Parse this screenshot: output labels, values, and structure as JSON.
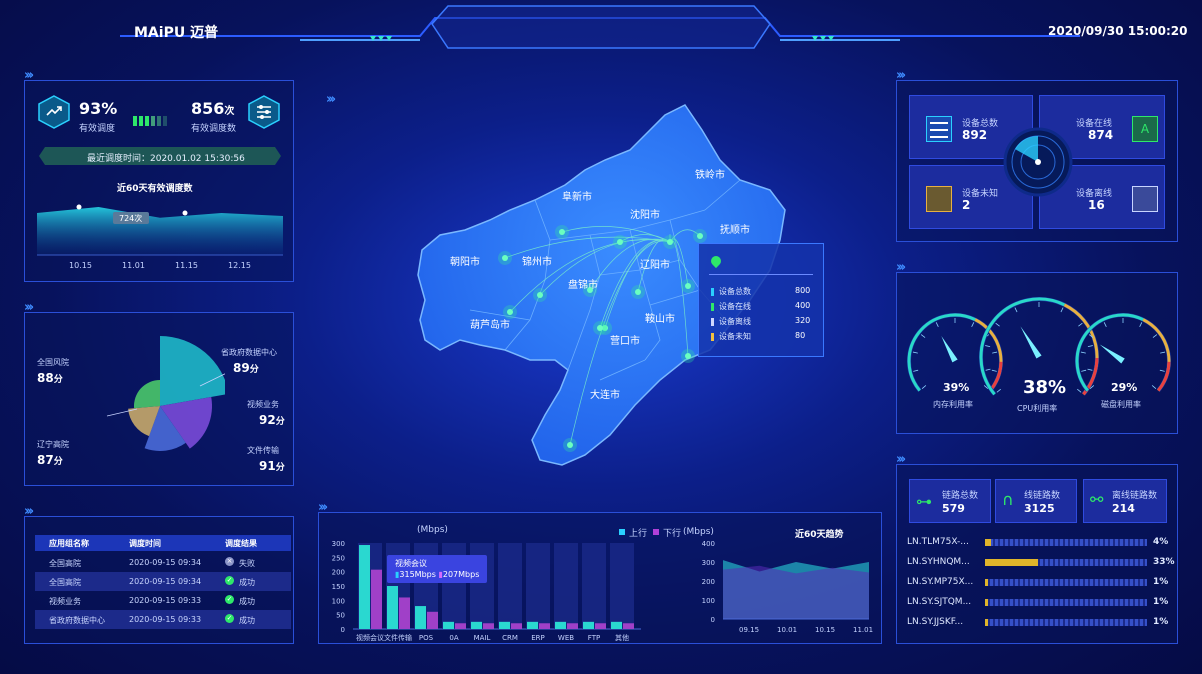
{
  "brand": {
    "logo_text": "MAiPU",
    "logo_cn": "迈普"
  },
  "datetime": "2020/09/30  15:00:20",
  "dispatch": {
    "rate_value": "93%",
    "rate_label": "有效调度",
    "count_value": "856",
    "count_unit": "次",
    "count_label": "有效调度数",
    "last_time": "最近调度时间：2020.01.02  15:30:56",
    "chart_title": "近60天有效调度数",
    "tooltip": "724次",
    "x_ticks": [
      "10.15",
      "11.01",
      "11.15",
      "12.15"
    ]
  },
  "score": {
    "items": [
      {
        "name": "全国风院",
        "value": "88",
        "unit": "分"
      },
      {
        "name": "省政府数据中心",
        "value": "89",
        "unit": "分"
      },
      {
        "name": "视频业务",
        "value": "92",
        "unit": "分"
      },
      {
        "name": "文件传输",
        "value": "91",
        "unit": "分"
      },
      {
        "name": "辽宁高院",
        "value": "87",
        "unit": "分"
      }
    ]
  },
  "table": {
    "headers": [
      "应用组名称",
      "调度时间",
      "调度结果"
    ],
    "rows": [
      {
        "name": "全国高院",
        "time": "2020-09-15 09:34",
        "result": "失败",
        "ok": false
      },
      {
        "name": "全国高院",
        "time": "2020-09-15 09:34",
        "result": "成功",
        "ok": true
      },
      {
        "name": "视频业务",
        "time": "2020-09-15 09:33",
        "result": "成功",
        "ok": true
      },
      {
        "name": "省政府数据中心",
        "time": "2020-09-15 09:33",
        "result": "成功",
        "ok": true
      }
    ]
  },
  "map": {
    "cities": [
      "铁岭市",
      "阜新市",
      "沈阳市",
      "抚顺市",
      "朝阳市",
      "锦州市",
      "辽阳市",
      "盘锦市",
      "鞍山市",
      "葫芦岛市",
      "营口市",
      "大连市"
    ],
    "tooltip": {
      "rows": [
        {
          "label": "设备总数",
          "value": "800",
          "color": "#2ad0ff"
        },
        {
          "label": "设备在线",
          "value": "400",
          "color": "#2ee86a"
        },
        {
          "label": "设备离线",
          "value": "320",
          "color": "#cfd8ff"
        },
        {
          "label": "设备未知",
          "value": "80",
          "color": "#f0c040"
        }
      ]
    }
  },
  "devices": {
    "total_label": "设备总数",
    "total": "892",
    "online_label": "设备在线",
    "online": "874",
    "unknown_label": "设备未知",
    "unknown": "2",
    "offline_label": "设备离线",
    "offline": "16"
  },
  "gauges": [
    {
      "value": "39%",
      "label": "内存利用率",
      "fraction": 0.39
    },
    {
      "value": "38%",
      "label": "CPU利用率",
      "fraction": 0.38
    },
    {
      "value": "29%",
      "label": "磁盘利用率",
      "fraction": 0.29
    }
  ],
  "links": {
    "total_label": "链路总数",
    "total": "579",
    "online_label": "线链路数",
    "online": "3125",
    "offline_label": "离线链路数",
    "offline": "214",
    "rows": [
      {
        "name": "LN.TLM75X-...",
        "pct": "4%",
        "fraction": 0.04
      },
      {
        "name": "LN.SYHNQM...",
        "pct": "33%",
        "fraction": 0.33
      },
      {
        "name": "LN.SY.MP75X...",
        "pct": "1%",
        "fraction": 0.01
      },
      {
        "name": "LN.SY.SJTQM...",
        "pct": "1%",
        "fraction": 0.01
      },
      {
        "name": "LN.SY.JJSKF...",
        "pct": "1%",
        "fraction": 0.01
      }
    ]
  },
  "traffic": {
    "unit": "(Mbps)",
    "legend_up": "上行",
    "legend_down": "下行",
    "tooltip_title": "视频会议",
    "tooltip_up": "315Mbps",
    "tooltip_down": "207Mbps"
  },
  "trend": {
    "unit": "(Mbps)",
    "title": "近60天趋势"
  },
  "chart_data": [
    {
      "type": "bar",
      "categories": [
        "视频会议",
        "文件传输",
        "POS",
        "0A",
        "MAIL",
        "CRM",
        "ERP",
        "WEB",
        "FTP",
        "其他"
      ],
      "series": [
        {
          "name": "上行",
          "values": [
            315,
            150,
            80,
            25,
            25,
            25,
            25,
            25,
            25,
            25
          ]
        },
        {
          "name": "下行",
          "values": [
            207,
            110,
            60,
            20,
            20,
            20,
            20,
            20,
            20,
            20
          ]
        }
      ],
      "ylabel": "(Mbps)",
      "ylim": [
        0,
        300
      ],
      "yticks": [
        0,
        50,
        100,
        150,
        200,
        250,
        300
      ]
    },
    {
      "type": "area",
      "title": "近60天趋势",
      "x": [
        "09.15",
        "10.01",
        "10.15",
        "11.01"
      ],
      "series": [
        {
          "values": [
            310,
            250,
            300,
            265,
            300
          ]
        },
        {
          "values": [
            260,
            280,
            240,
            270,
            245
          ]
        }
      ],
      "ylabel": "(Mbps)",
      "ylim": [
        0,
        400
      ],
      "yticks": [
        0,
        100,
        200,
        300,
        400
      ]
    },
    {
      "type": "area",
      "title": "近60天有效调度数",
      "x": [
        "10.15",
        "11.01",
        "11.15",
        "12.15"
      ],
      "series": [
        {
          "values": [
            740,
            760,
            724,
            740,
            730
          ]
        }
      ]
    },
    {
      "type": "pie",
      "categories": [
        "全国风院",
        "省政府数据中心",
        "视频业务",
        "文件传输",
        "辽宁高院"
      ],
      "values": [
        88,
        89,
        92,
        91,
        87
      ]
    }
  ]
}
